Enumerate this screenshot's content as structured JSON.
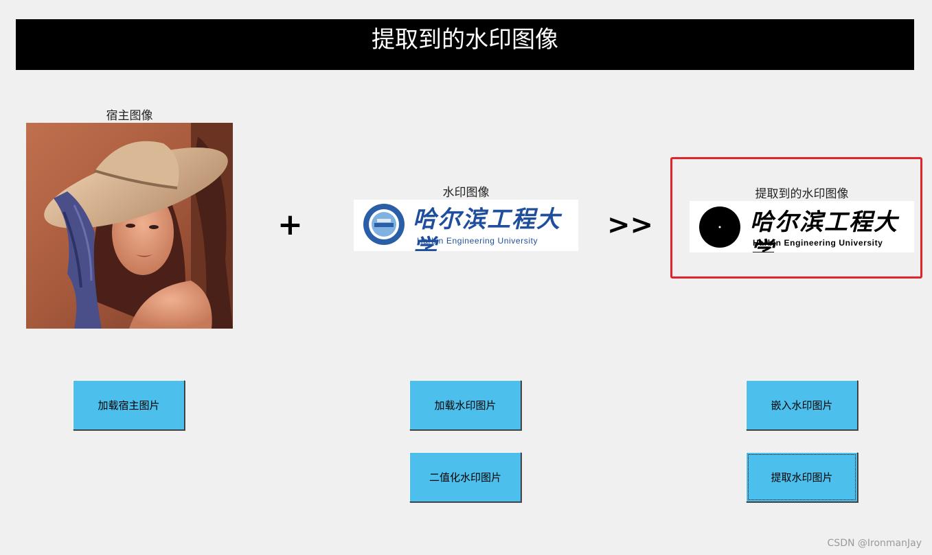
{
  "header": {
    "title": "提取到的水印图像"
  },
  "host_panel": {
    "label": "宿主图像"
  },
  "watermark_panel": {
    "label": "水印图像",
    "logo_text": "哈尔滨工程大学",
    "logo_subtext": "Harbin Engineering University"
  },
  "extracted_panel": {
    "label": "提取到的水印图像",
    "logo_text": "哈尔滨工程大学",
    "logo_subtext": "Harbin Engineering University"
  },
  "operators": {
    "plus": "+",
    "arrow": ">>"
  },
  "buttons": {
    "load_host": "加载宿主图片",
    "load_watermark": "加载水印图片",
    "binarize_watermark": "二值化水印图片",
    "embed_watermark": "嵌入水印图片",
    "extract_watermark": "提取水印图片"
  },
  "credit": "CSDN @IronmanJay",
  "colors": {
    "button_fill": "#4dbfec",
    "highlight_border": "#e0242b",
    "title_bg": "#000000",
    "logo_blue": "#1f4e9c"
  }
}
